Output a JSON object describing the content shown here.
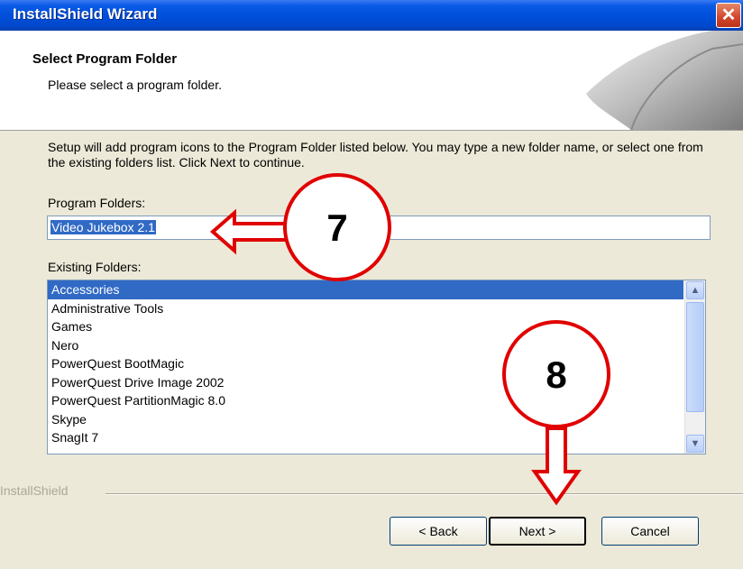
{
  "window": {
    "title": "InstallShield Wizard",
    "close_glyph": "✕"
  },
  "header": {
    "title": "Select Program Folder",
    "subtitle": "Please select a program folder."
  },
  "body": {
    "description": "Setup will add program icons to the Program Folder listed below.  You may type a new folder name, or select one from the existing folders list.  Click Next to continue.",
    "program_folders_label": "Program Folders:",
    "program_folder_value": "Video Jukebox 2.1",
    "existing_folders_label": "Existing Folders:",
    "existing_folders": [
      "Accessories",
      "Administrative Tools",
      "Games",
      "Nero",
      "PowerQuest BootMagic",
      "PowerQuest Drive Image 2002",
      "PowerQuest PartitionMagic 8.0",
      "Skype",
      "SnagIt 7"
    ],
    "selected_index": 0
  },
  "footer": {
    "brand": "InstallShield",
    "back_label": "< Back",
    "next_label": "Next >",
    "cancel_label": "Cancel"
  },
  "annotations": {
    "step_a": "7",
    "step_b": "8",
    "color": "#e00000"
  },
  "icons": {
    "scroll_up": "chevron-up-icon",
    "scroll_down": "chevron-down-icon",
    "close": "close-icon"
  }
}
